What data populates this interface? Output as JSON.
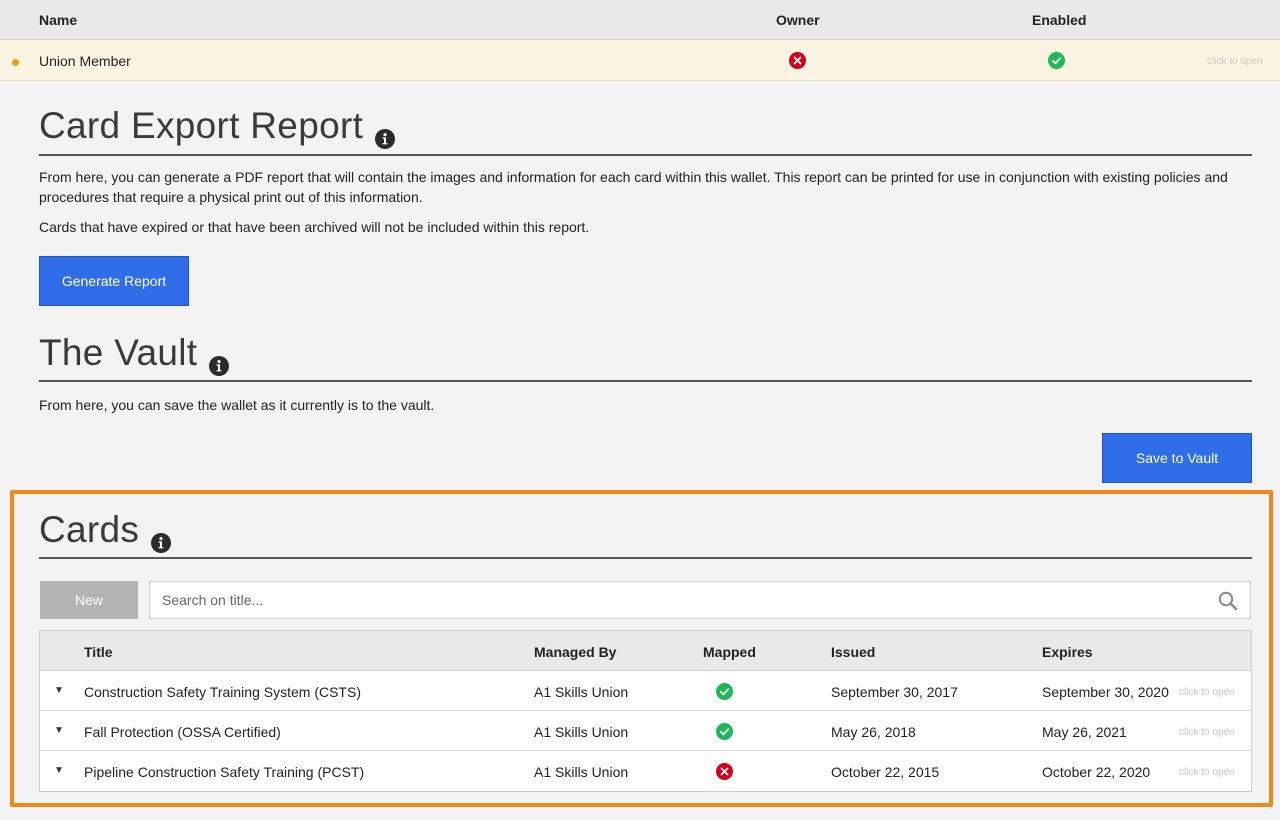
{
  "members": {
    "columns": {
      "name": "Name",
      "owner": "Owner",
      "enabled": "Enabled"
    },
    "row": {
      "name": "Union Member",
      "owner": "no",
      "enabled": "yes",
      "hint": "click to open"
    }
  },
  "export_report": {
    "title": "Card Export Report",
    "para1": "From here, you can generate a PDF report that will contain the images and information for each card within this wallet. This report can be printed for use in conjunction with existing policies and procedures that require a physical print out of this information.",
    "para2": "Cards that have expired or that have been archived will not be included within this report.",
    "button": "Generate Report"
  },
  "vault": {
    "title": "The Vault",
    "para": "From here, you can save the wallet as it currently is to the vault.",
    "button": "Save to Vault"
  },
  "cards": {
    "title": "Cards",
    "new_button": "New",
    "search_placeholder": "Search on title...",
    "columns": {
      "title": "Title",
      "managed_by": "Managed By",
      "mapped": "Mapped",
      "issued": "Issued",
      "expires": "Expires"
    },
    "rows": [
      {
        "title": "Construction Safety Training System (CSTS)",
        "managed_by": "A1 Skills Union",
        "mapped": "yes",
        "issued": "September 30, 2017",
        "expires": "September 30, 2020",
        "hint": "click to open"
      },
      {
        "title": "Fall Protection (OSSA Certified)",
        "managed_by": "A1 Skills Union",
        "mapped": "yes",
        "issued": "May 26, 2018",
        "expires": "May 26, 2021",
        "hint": "click to open"
      },
      {
        "title": "Pipeline Construction Safety Training (PCST)",
        "managed_by": "A1 Skills Union",
        "mapped": "no",
        "issued": "October 22, 2015",
        "expires": "October 22, 2020",
        "hint": "click to open"
      }
    ]
  },
  "colors": {
    "accent_button": "#2f6ee8",
    "highlight_border": "#f0891a",
    "status_yes": "#1db954",
    "status_no": "#d0021b",
    "active_dot": "#f39c12"
  },
  "icons": [
    "info-icon",
    "search-icon",
    "check-circle-icon",
    "x-circle-icon",
    "caret-down-icon"
  ]
}
